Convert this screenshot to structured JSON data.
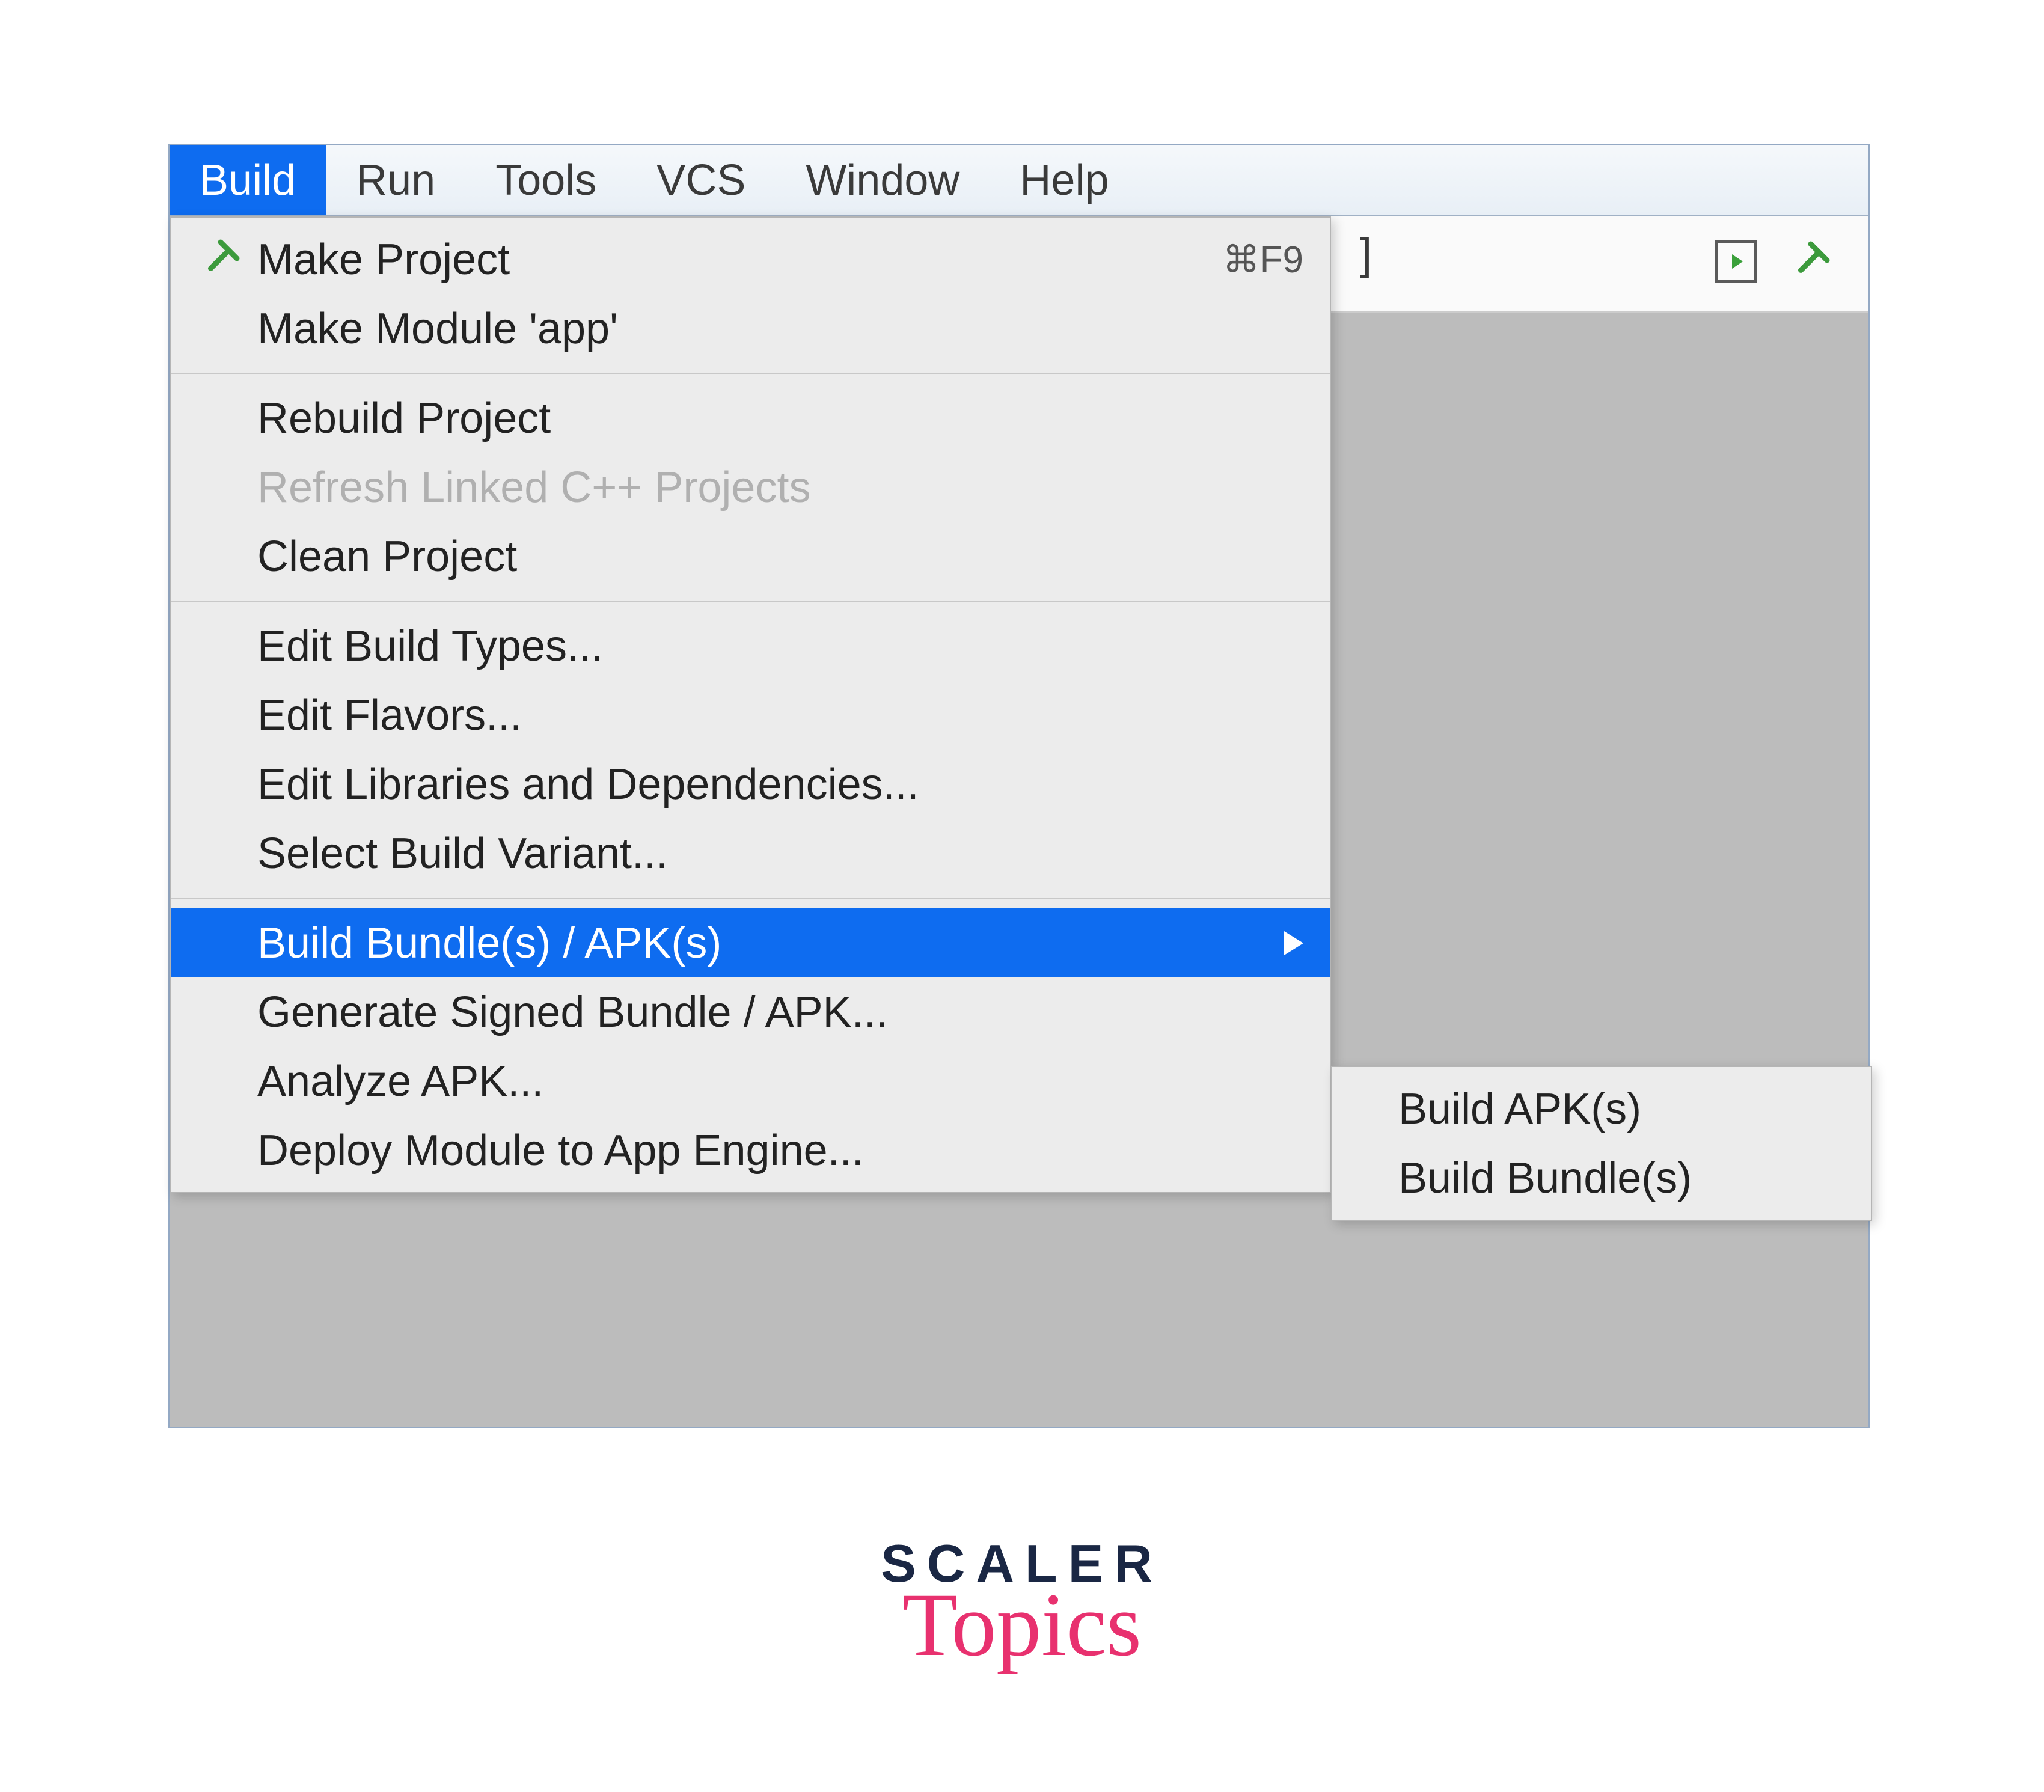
{
  "menubar": {
    "items": [
      {
        "label": "Build",
        "active": true
      },
      {
        "label": "Run",
        "active": false
      },
      {
        "label": "Tools",
        "active": false
      },
      {
        "label": "VCS",
        "active": false
      },
      {
        "label": "Window",
        "active": false
      },
      {
        "label": "Help",
        "active": false
      }
    ]
  },
  "build_menu": {
    "groups": [
      [
        {
          "label": "Make Project",
          "icon": "hammer",
          "shortcut": "⌘F9",
          "disabled": false
        },
        {
          "label": "Make Module 'app'",
          "icon": null,
          "shortcut": null,
          "disabled": false
        }
      ],
      [
        {
          "label": "Rebuild Project",
          "icon": null,
          "shortcut": null,
          "disabled": false
        },
        {
          "label": "Refresh Linked C++ Projects",
          "icon": null,
          "shortcut": null,
          "disabled": true
        },
        {
          "label": "Clean Project",
          "icon": null,
          "shortcut": null,
          "disabled": false
        }
      ],
      [
        {
          "label": "Edit Build Types...",
          "icon": null,
          "shortcut": null,
          "disabled": false
        },
        {
          "label": "Edit Flavors...",
          "icon": null,
          "shortcut": null,
          "disabled": false
        },
        {
          "label": "Edit Libraries and Dependencies...",
          "icon": null,
          "shortcut": null,
          "disabled": false
        },
        {
          "label": "Select Build Variant...",
          "icon": null,
          "shortcut": null,
          "disabled": false
        }
      ],
      [
        {
          "label": "Build Bundle(s) / APK(s)",
          "icon": null,
          "shortcut": null,
          "disabled": false,
          "highlight": true,
          "submenu": true
        },
        {
          "label": "Generate Signed Bundle / APK...",
          "icon": null,
          "shortcut": null,
          "disabled": false
        },
        {
          "label": "Analyze APK...",
          "icon": null,
          "shortcut": null,
          "disabled": false
        },
        {
          "label": "Deploy Module to App Engine...",
          "icon": null,
          "shortcut": null,
          "disabled": false
        }
      ]
    ]
  },
  "submenu": {
    "items": [
      {
        "label": "Build APK(s)"
      },
      {
        "label": "Build Bundle(s)"
      }
    ]
  },
  "toolbar": {
    "extra_symbol": "]"
  },
  "brand": {
    "line1": "SCALER",
    "line2": "Topics"
  },
  "colors": {
    "highlight": "#0e6cf0",
    "menu_bg": "#ececec",
    "hammer": "#3c9a3c"
  }
}
